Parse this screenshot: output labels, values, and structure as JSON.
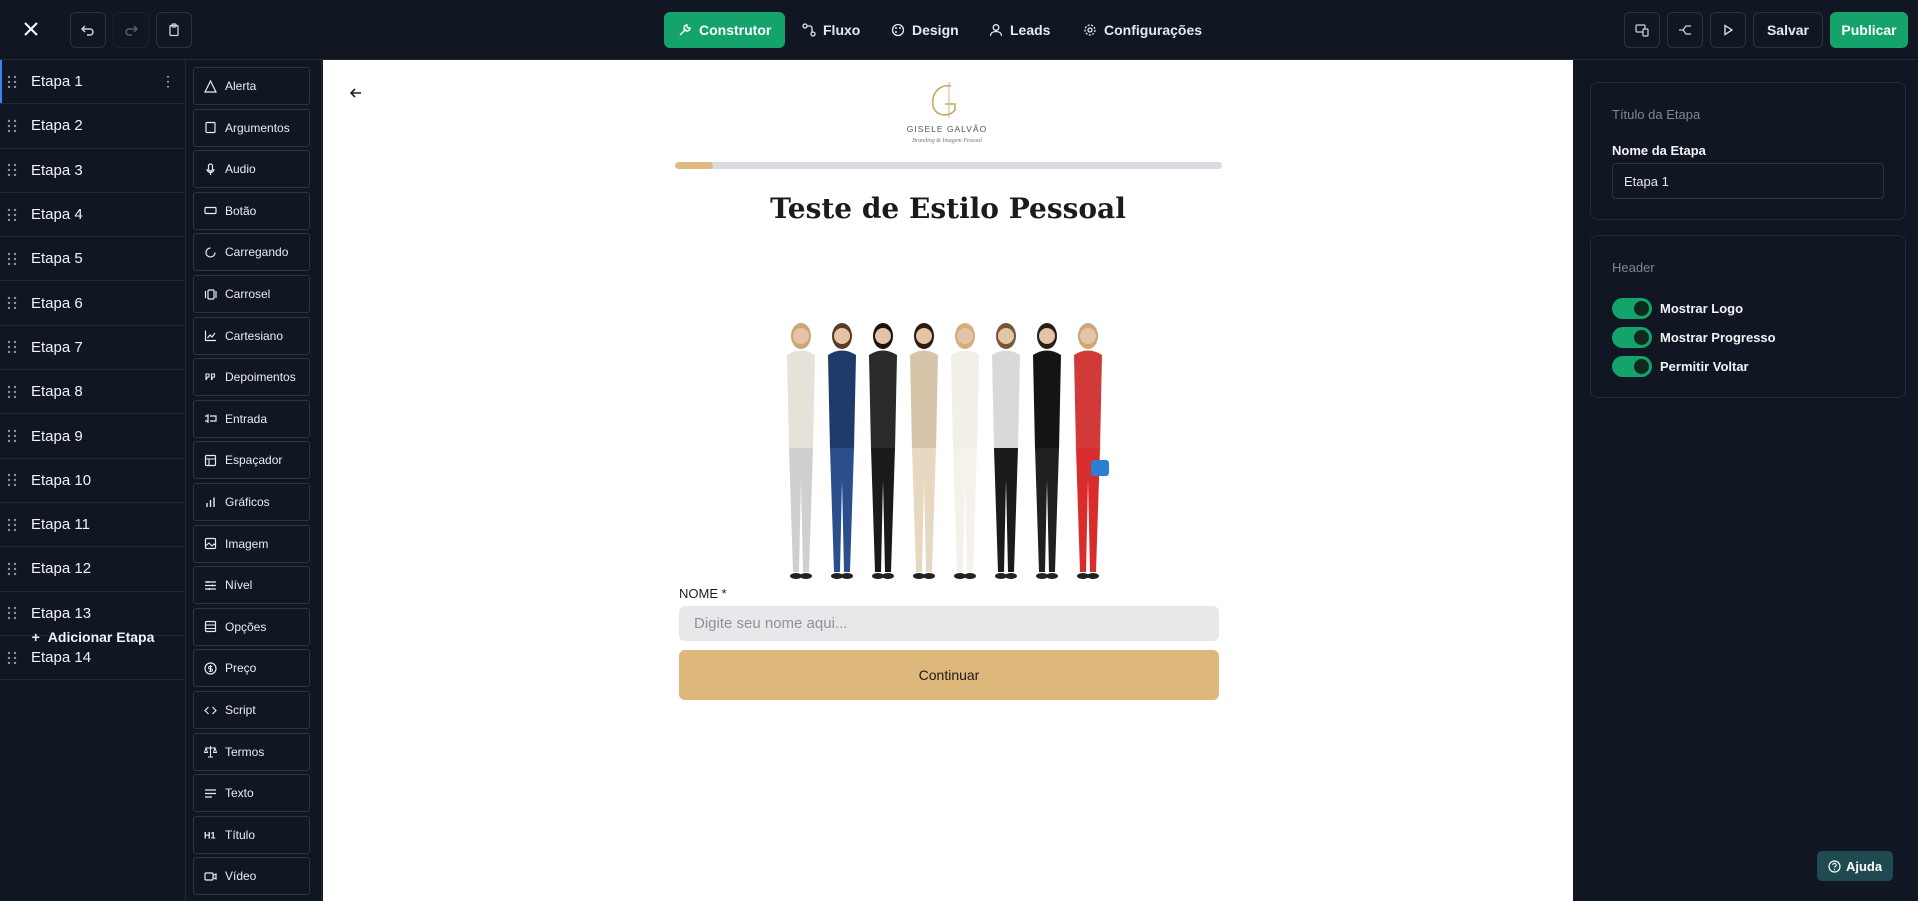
{
  "topbar": {
    "nav": [
      {
        "label": "Construtor",
        "icon": "wrench-icon",
        "active": true
      },
      {
        "label": "Fluxo",
        "icon": "flow-icon"
      },
      {
        "label": "Design",
        "icon": "palette-icon"
      },
      {
        "label": "Leads",
        "icon": "user-icon"
      },
      {
        "label": "Configurações",
        "icon": "gear-icon"
      }
    ],
    "save_label": "Salvar",
    "publish_label": "Publicar"
  },
  "steps": {
    "items": [
      "Etapa 1",
      "Etapa 2",
      "Etapa 3",
      "Etapa 4",
      "Etapa 5",
      "Etapa 6",
      "Etapa 7",
      "Etapa 8",
      "Etapa 9",
      "Etapa 10",
      "Etapa 11",
      "Etapa 12",
      "Etapa 13",
      "Etapa 14"
    ],
    "add_label": "Adicionar Etapa"
  },
  "components": [
    "Alerta",
    "Argumentos",
    "Audio",
    "Botão",
    "Carregando",
    "Carrosel",
    "Cartesiano",
    "Depoimentos",
    "Entrada",
    "Espaçador",
    "Gráficos",
    "Imagem",
    "Nível",
    "Opções",
    "Preço",
    "Script",
    "Termos",
    "Texto",
    "Título",
    "Vídeo"
  ],
  "canvas": {
    "logo_name": "GISELE GALVÃO",
    "logo_tagline": "Branding & Imagem Pessoal",
    "progress": 0.07,
    "title": "Teste de Estilo Pessoal",
    "field_label": "NOME *",
    "field_placeholder": "Digite seu nome aqui...",
    "cta_label": "Continuar"
  },
  "props": {
    "section_title": "Título da Etapa",
    "name_label": "Nome da Etapa",
    "name_value": "Etapa 1",
    "header_title": "Header",
    "toggles": [
      "Mostrar Logo",
      "Mostrar Progresso",
      "Permitir Voltar"
    ]
  },
  "help_label": "Ajuda",
  "colors": {
    "accent": "#14a36b",
    "cta": "#deb77b",
    "bg": "#111722"
  }
}
